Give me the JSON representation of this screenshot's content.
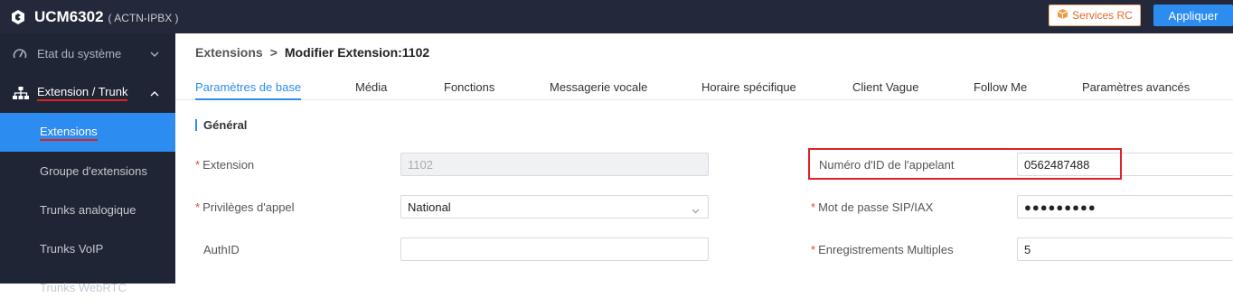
{
  "header": {
    "title": "UCM6302",
    "subtitle": "( ACTN-IPBX )",
    "services_label": "Services RC",
    "apply_label": "Appliquer"
  },
  "sidebar": {
    "groups": [
      {
        "label": "Etat du système",
        "icon": "gauge-icon"
      },
      {
        "label": "Extension / Trunk",
        "icon": "network-icon"
      }
    ],
    "items": [
      {
        "label": "Extensions"
      },
      {
        "label": "Groupe d'extensions"
      },
      {
        "label": "Trunks analogique"
      },
      {
        "label": "Trunks VoIP"
      },
      {
        "label": "Trunks WebRTC"
      }
    ]
  },
  "breadcrumb": {
    "parent": "Extensions",
    "separator": ">",
    "current": "Modifier Extension:1102"
  },
  "tabs": [
    {
      "label": "Paramètres de base"
    },
    {
      "label": "Média"
    },
    {
      "label": "Fonctions"
    },
    {
      "label": "Messagerie vocale"
    },
    {
      "label": "Horaire spécifique"
    },
    {
      "label": "Client Vague"
    },
    {
      "label": "Follow Me"
    },
    {
      "label": "Paramètres avancés"
    }
  ],
  "section_title": "Général",
  "form": {
    "required_mark": "*",
    "extension": {
      "label": "Extension",
      "value": "1102"
    },
    "call_privileges": {
      "label": "Privilèges d'appel",
      "value": "National"
    },
    "authid": {
      "label": "AuthID",
      "value": ""
    },
    "caller_id": {
      "label": "Numéro d'ID de l'appelant",
      "value": "0562487488"
    },
    "sip_password": {
      "label": "Mot de passe SIP/IAX",
      "value": "●●●●●●●●●"
    },
    "multiple_registrations": {
      "label": "Enregistrements Multiples",
      "value": "5"
    }
  },
  "colors": {
    "accent": "#2d8cf0",
    "topbar": "#23293a",
    "sidebar": "#1f2534",
    "highlight": "#e0202a"
  }
}
